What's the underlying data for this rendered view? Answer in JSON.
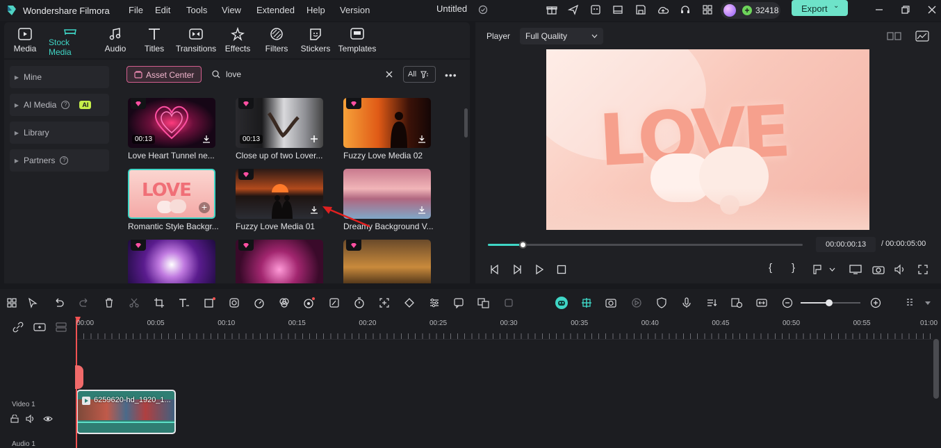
{
  "app": {
    "name": "Wondershare Filmora",
    "project_title": "Untitled"
  },
  "menu": [
    "File",
    "Edit",
    "Tools",
    "View",
    "Extended",
    "Help",
    "Version"
  ],
  "credits": "32418",
  "export_label": "Export",
  "tabs": [
    {
      "label": "Media",
      "icon": "media-icon"
    },
    {
      "label": "Stock Media",
      "icon": "stock-media-icon"
    },
    {
      "label": "Audio",
      "icon": "music-note-icon"
    },
    {
      "label": "Titles",
      "icon": "text-t-icon"
    },
    {
      "label": "Transitions",
      "icon": "transitions-icon"
    },
    {
      "label": "Effects",
      "icon": "effects-icon"
    },
    {
      "label": "Filters",
      "icon": "filters-icon"
    },
    {
      "label": "Stickers",
      "icon": "stickers-icon"
    },
    {
      "label": "Templates",
      "icon": "templates-icon"
    }
  ],
  "sidebar": {
    "items": [
      {
        "label": "Mine"
      },
      {
        "label": "AI Media",
        "badge": "AI"
      },
      {
        "label": "Library"
      },
      {
        "label": "Partners"
      }
    ]
  },
  "browser": {
    "asset_center": "Asset Center",
    "search_value": "love",
    "filter_label": "All",
    "items": [
      {
        "name": "Love Heart Tunnel ne...",
        "duration": "00:13"
      },
      {
        "name": "Close up of two Lover...",
        "duration": "00:13"
      },
      {
        "name": "Fuzzy Love Media 02",
        "duration": ""
      },
      {
        "name": "Romantic Style Backgr...",
        "duration": ""
      },
      {
        "name": "Fuzzy Love Media 01",
        "duration": ""
      },
      {
        "name": "Dreamy Background V...",
        "duration": ""
      }
    ]
  },
  "player": {
    "label": "Player",
    "quality": "Full Quality",
    "current_time": "00:00:00:13",
    "total_time": "/ 00:00:05:00",
    "progress": 0.11
  },
  "timeline": {
    "ruler": [
      "00:00",
      "00:05",
      "00:10",
      "00:15",
      "00:20",
      "00:25",
      "00:30",
      "00:35",
      "00:40",
      "00:45",
      "00:50",
      "00:55",
      "01:00"
    ],
    "tracks": {
      "video": "Video 1",
      "audio": "Audio 1"
    },
    "clip_name": "6259620-hd_1920_1..."
  },
  "colors": {
    "accent": "#3fd6c6",
    "export_bg": "#6ee3c9",
    "playhead": "#f05252",
    "clip_bg": "#2f7e73"
  }
}
